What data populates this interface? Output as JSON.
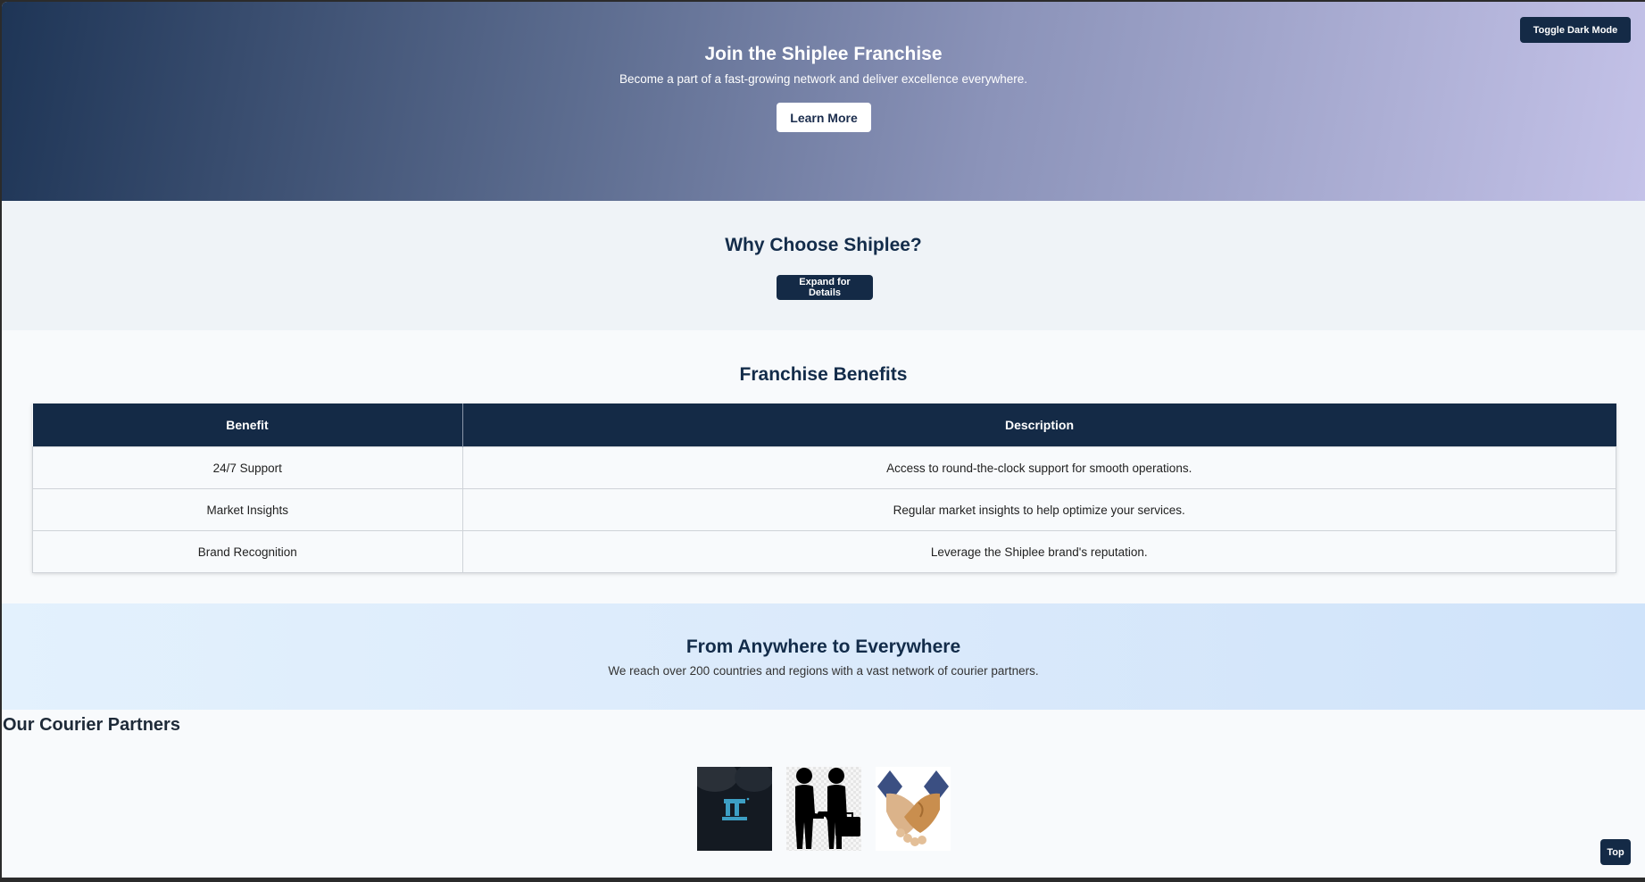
{
  "hero": {
    "title": "Join the Shiplee Franchise",
    "subtitle": "Become a part of a fast-growing network and deliver excellence everywhere.",
    "cta_label": "Learn More",
    "dark_mode_label": "Toggle Dark Mode"
  },
  "why": {
    "title": "Why Choose Shiplee?",
    "expand_label": "Expand for Details"
  },
  "benefits": {
    "title": "Franchise Benefits",
    "headers": [
      "Benefit",
      "Description"
    ],
    "rows": [
      {
        "benefit": "24/7 Support",
        "description": "Access to round-the-clock support for smooth operations."
      },
      {
        "benefit": "Market Insights",
        "description": "Regular market insights to help optimize your services."
      },
      {
        "benefit": "Brand Recognition",
        "description": "Leverage the Shiplee brand's reputation."
      }
    ]
  },
  "anywhere": {
    "title": "From Anywhere to Everywhere",
    "subtitle": "We reach over 200 countries and regions with a vast network of courier partners."
  },
  "partners": {
    "title": "Our Courier Partners",
    "logos": [
      "partner-logo-dark",
      "partner-logo-business-handshake",
      "partner-logo-handshake"
    ]
  },
  "scroll_top_label": "Top",
  "colors": {
    "navy": "#142a46",
    "hero_start": "#1e3556",
    "hero_end": "#c4c2e8",
    "band_light": "#dbeafb"
  }
}
